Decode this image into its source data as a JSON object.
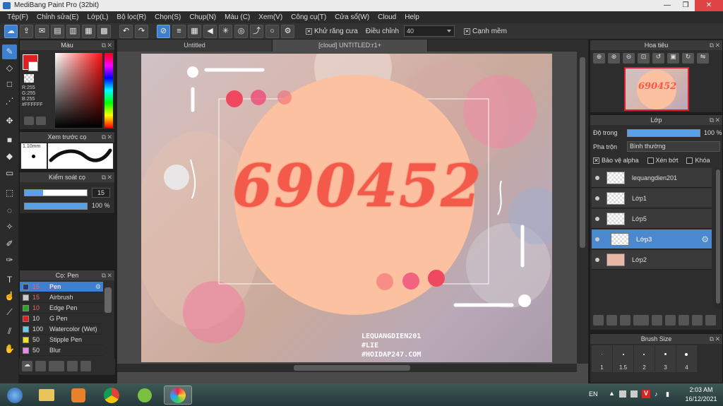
{
  "window": {
    "title": "MediBang Paint Pro (32bit)",
    "buttons": [
      "—",
      "❒",
      "✕"
    ]
  },
  "menu": [
    "Tệp(F)",
    "Chỉnh sửa(E)",
    "Lớp(L)",
    "Bộ lọc(R)",
    "Chọn(S)",
    "Chụp(N)",
    "Màu (C)",
    "Xem(V)",
    "Công cụ(T)",
    "Cửa sổ(W)",
    "Cloud",
    "Help"
  ],
  "toolbar": {
    "antialias_label": "Khử răng cưa",
    "adjust_label": "Điều chỉnh",
    "adjust_value": "40",
    "sharp_label": "Cạnh mềm"
  },
  "color_panel": {
    "title": "Màu",
    "r": "R:255",
    "g": "G:255",
    "b": "B:255",
    "hex": "#FFFFFF"
  },
  "preview_panel": {
    "title": "Xem trước cọ",
    "size": "1.10mm"
  },
  "control_panel": {
    "title": "Kiểm soát cọ",
    "size": "15",
    "opacity": "100 %"
  },
  "brush_panel": {
    "title": "Cọ: Pen",
    "items": [
      {
        "size": "15",
        "name": "Pen",
        "color": "#1f3a6e",
        "selected": true
      },
      {
        "size": "15",
        "name": "Airbrush",
        "color": "#cccccc"
      },
      {
        "size": "10",
        "name": "Edge Pen",
        "color": "#22aa22"
      },
      {
        "size": "10",
        "name": "G Pen",
        "color": "#dd2222"
      },
      {
        "size": "100",
        "name": "Watercolor (Wet)",
        "color": "#66ccee"
      },
      {
        "size": "50",
        "name": "Stipple Pen",
        "color": "#eedd33"
      },
      {
        "size": "50",
        "name": "Blur",
        "color": "#ee88ee"
      }
    ]
  },
  "tabs": [
    {
      "label": "Untitled"
    },
    {
      "label": "[cloud] UNTITLED:r1+"
    }
  ],
  "artwork": {
    "number": "690452",
    "watermark1": "LEQUANGDIEN201",
    "watermark2": "#LIE",
    "watermark3": "#HOIDAP247.COM"
  },
  "navigator_panel": {
    "title": "Hoa tiêu"
  },
  "layer_panel": {
    "title": "Lớp",
    "opacity_label": "Độ trong",
    "opacity_value": "100 %",
    "blend_label": "Pha trộn",
    "blend_value": "Bình thường",
    "alpha_label": "Bảo vệ alpha",
    "clip_label": "Xén bớt",
    "lock_label": "Khóa",
    "layers": [
      {
        "name": "lequangdien201"
      },
      {
        "name": "Lớp1"
      },
      {
        "name": "Lớp5"
      },
      {
        "name": "Lớp3",
        "selected": true
      },
      {
        "name": "Lớp2"
      }
    ]
  },
  "brush_size_panel": {
    "title": "Brush Size",
    "sizes": [
      "1",
      "1.5",
      "2",
      "3",
      "4"
    ]
  },
  "taskbar": {
    "lang": "EN",
    "time": "2:03 AM",
    "date": "16/12/2021"
  }
}
